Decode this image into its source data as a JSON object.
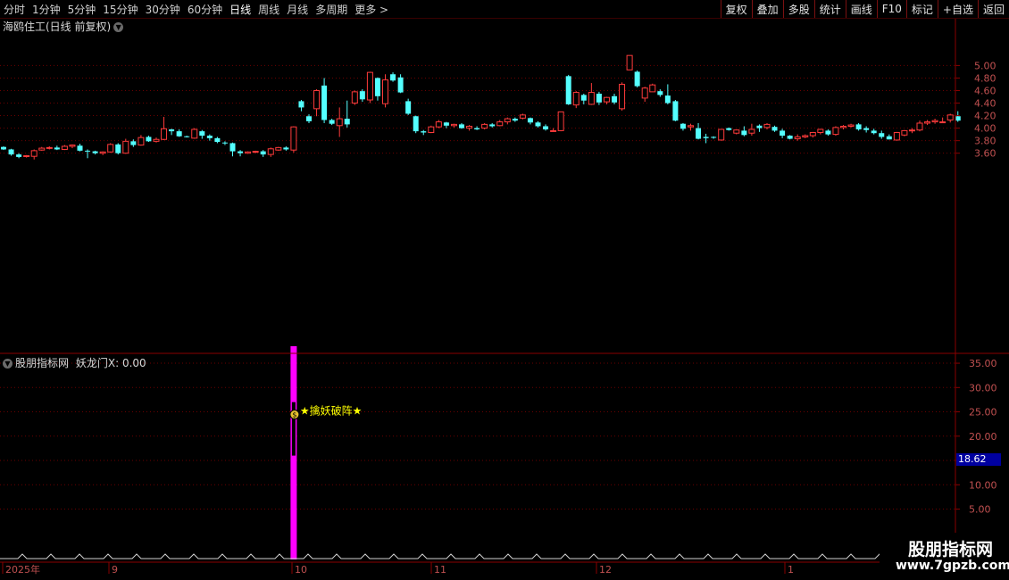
{
  "toolbar": {
    "periods": [
      "分时",
      "1分钟",
      "5分钟",
      "15分钟",
      "30分钟",
      "60分钟",
      "日线",
      "周线",
      "月线",
      "多周期",
      "更多 >"
    ],
    "active_period": "日线",
    "buttons": [
      "复权",
      "叠加",
      "多股",
      "统计",
      "画线",
      "F10",
      "标记",
      "+自选",
      "返回"
    ]
  },
  "main_chart": {
    "title": "海鸥住工(日线 前复权)",
    "y_ticks": [
      "5.00",
      "4.80",
      "4.60",
      "4.40",
      "4.20",
      "4.00",
      "3.80",
      "3.60"
    ]
  },
  "indicator": {
    "name": "股朋指标网",
    "label": "妖龙门X:",
    "value": "0.00",
    "signal_label": "擒妖破阵",
    "y_ticks": [
      "35.00",
      "30.00",
      "25.00",
      "20.00",
      "15.00",
      "10.00",
      "5.00"
    ],
    "price_tag": "18.62"
  },
  "x_axis": {
    "labels": [
      "2025年",
      "9",
      "10",
      "11",
      "12",
      "1"
    ]
  },
  "watermark": {
    "line1": "股朋指标网",
    "line2": "www.7gpzb.com"
  },
  "colors": {
    "up": "#ff3b3b",
    "down": "#54ffff",
    "grid": "#6b0000",
    "signal": "#ff00ff"
  },
  "chart_data": {
    "type": "candlestick",
    "ylim": [
      3.4,
      5.2
    ],
    "candles": [
      [
        3.7,
        3.66,
        3.71,
        3.65
      ],
      [
        3.66,
        3.58,
        3.67,
        3.56
      ],
      [
        3.58,
        3.54,
        3.6,
        3.52
      ],
      [
        3.55,
        3.56,
        3.57,
        3.53
      ],
      [
        3.55,
        3.64,
        3.66,
        3.5
      ],
      [
        3.65,
        3.68,
        3.7,
        3.64
      ],
      [
        3.68,
        3.69,
        3.71,
        3.66
      ],
      [
        3.69,
        3.66,
        3.72,
        3.65
      ],
      [
        3.66,
        3.71,
        3.73,
        3.65
      ],
      [
        3.71,
        3.73,
        3.74,
        3.68
      ],
      [
        3.72,
        3.64,
        3.75,
        3.63
      ],
      [
        3.64,
        3.63,
        3.66,
        3.52
      ],
      [
        3.63,
        3.6,
        3.64,
        3.58
      ],
      [
        3.6,
        3.62,
        3.63,
        3.57
      ],
      [
        3.62,
        3.74,
        3.76,
        3.61
      ],
      [
        3.74,
        3.6,
        3.76,
        3.58
      ],
      [
        3.6,
        3.79,
        3.83,
        3.59
      ],
      [
        3.79,
        3.73,
        3.82,
        3.7
      ],
      [
        3.73,
        3.85,
        3.89,
        3.72
      ],
      [
        3.86,
        3.79,
        3.88,
        3.78
      ],
      [
        3.79,
        3.82,
        3.85,
        3.77
      ],
      [
        3.82,
        3.99,
        4.18,
        3.81
      ],
      [
        3.98,
        3.95,
        3.99,
        3.89
      ],
      [
        3.95,
        3.87,
        3.98,
        3.86
      ],
      [
        3.87,
        3.86,
        3.88,
        3.85
      ],
      [
        3.84,
        3.98,
        4.0,
        3.83
      ],
      [
        3.95,
        3.88,
        3.97,
        3.83
      ],
      [
        3.88,
        3.84,
        3.9,
        3.8
      ],
      [
        3.84,
        3.78,
        3.86,
        3.76
      ],
      [
        3.77,
        3.76,
        3.79,
        3.73
      ],
      [
        3.76,
        3.63,
        3.77,
        3.55
      ],
      [
        3.63,
        3.6,
        3.65,
        3.55
      ],
      [
        3.6,
        3.62,
        3.63,
        3.59
      ],
      [
        3.62,
        3.63,
        3.64,
        3.6
      ],
      [
        3.63,
        3.58,
        3.65,
        3.54
      ],
      [
        3.58,
        3.67,
        3.69,
        3.54
      ],
      [
        3.65,
        3.69,
        3.7,
        3.64
      ],
      [
        3.69,
        3.66,
        3.71,
        3.64
      ],
      [
        3.65,
        4.02,
        4.03,
        3.61
      ],
      [
        4.43,
        4.33,
        4.45,
        4.27
      ],
      [
        4.19,
        4.11,
        4.22,
        4.08
      ],
      [
        4.31,
        4.6,
        4.62,
        4.19
      ],
      [
        4.68,
        4.13,
        4.8,
        4.08
      ],
      [
        4.13,
        4.07,
        4.15,
        4.05
      ],
      [
        4.04,
        4.15,
        4.33,
        3.86
      ],
      [
        4.15,
        4.06,
        4.44,
        4.01
      ],
      [
        4.4,
        4.58,
        4.6,
        4.37
      ],
      [
        4.59,
        4.46,
        4.62,
        4.42
      ],
      [
        4.45,
        4.89,
        4.9,
        4.4
      ],
      [
        4.8,
        4.51,
        4.81,
        4.44
      ],
      [
        4.39,
        4.77,
        4.86,
        4.33
      ],
      [
        4.86,
        4.76,
        4.89,
        4.74
      ],
      [
        4.81,
        4.57,
        4.86,
        4.56
      ],
      [
        4.43,
        4.23,
        4.47,
        4.21
      ],
      [
        4.19,
        3.95,
        4.2,
        3.92
      ],
      [
        3.95,
        3.93,
        3.97,
        3.89
      ],
      [
        3.93,
        4.02,
        4.04,
        3.92
      ],
      [
        4.02,
        4.1,
        4.13,
        4.0
      ],
      [
        4.09,
        4.04,
        4.1,
        4.0
      ],
      [
        4.04,
        4.06,
        4.07,
        4.01
      ],
      [
        4.06,
        4.0,
        4.08,
        3.99
      ],
      [
        4.0,
        4.03,
        4.05,
        3.96
      ],
      [
        4.0,
        3.98,
        4.03,
        3.97
      ],
      [
        4.0,
        4.06,
        4.08,
        3.98
      ],
      [
        4.06,
        4.03,
        4.08,
        4.01
      ],
      [
        4.04,
        4.1,
        4.13,
        4.03
      ],
      [
        4.1,
        4.15,
        4.17,
        4.06
      ],
      [
        4.15,
        4.12,
        4.17,
        4.1
      ],
      [
        4.16,
        4.21,
        4.23,
        4.14
      ],
      [
        4.16,
        4.09,
        4.17,
        4.06
      ],
      [
        4.09,
        4.03,
        4.11,
        4.01
      ],
      [
        4.03,
        3.98,
        4.06,
        3.96
      ],
      [
        3.96,
        3.96,
        4.0,
        3.96
      ],
      [
        3.96,
        4.26,
        4.26,
        3.95
      ],
      [
        4.83,
        4.38,
        4.85,
        4.37
      ],
      [
        4.37,
        4.57,
        4.59,
        4.32
      ],
      [
        4.53,
        4.44,
        4.55,
        4.38
      ],
      [
        4.38,
        4.57,
        4.72,
        4.37
      ],
      [
        4.55,
        4.41,
        4.58,
        4.37
      ],
      [
        4.42,
        4.49,
        4.5,
        4.38
      ],
      [
        4.51,
        4.41,
        4.55,
        4.38
      ],
      [
        4.31,
        4.7,
        4.73,
        4.28
      ],
      [
        4.93,
        5.16,
        5.16,
        4.95
      ],
      [
        4.9,
        4.67,
        4.92,
        4.65
      ],
      [
        4.48,
        4.64,
        4.66,
        4.42
      ],
      [
        4.58,
        4.69,
        4.71,
        4.6
      ],
      [
        4.59,
        4.53,
        4.62,
        4.5
      ],
      [
        4.52,
        4.4,
        4.7,
        4.38
      ],
      [
        4.43,
        4.12,
        4.45,
        4.11
      ],
      [
        4.07,
        3.99,
        4.08,
        3.96
      ],
      [
        4.02,
        4.04,
        4.07,
        3.96
      ],
      [
        4.0,
        3.83,
        4.08,
        3.82
      ],
      [
        3.86,
        3.84,
        3.91,
        3.76
      ],
      [
        3.86,
        3.85,
        3.87,
        3.83
      ],
      [
        3.81,
        3.98,
        3.97,
        3.8
      ],
      [
        4.0,
        3.97,
        4.01,
        3.96
      ],
      [
        3.92,
        3.97,
        3.98,
        3.9
      ],
      [
        3.96,
        3.89,
        4.03,
        3.87
      ],
      [
        3.92,
        3.98,
        4.07,
        3.88
      ],
      [
        4.04,
        4.0,
        4.06,
        3.94
      ],
      [
        4.01,
        4.06,
        4.08,
        3.98
      ],
      [
        4.02,
        3.96,
        4.04,
        3.94
      ],
      [
        3.96,
        3.88,
        3.99,
        3.84
      ],
      [
        3.88,
        3.83,
        3.89,
        3.82
      ],
      [
        3.83,
        3.86,
        3.9,
        3.8
      ],
      [
        3.86,
        3.88,
        3.9,
        3.84
      ],
      [
        3.88,
        3.93,
        3.94,
        3.85
      ],
      [
        3.93,
        3.98,
        3.99,
        3.9
      ],
      [
        3.96,
        3.9,
        3.98,
        3.88
      ],
      [
        3.9,
        4.01,
        4.03,
        3.88
      ],
      [
        4.01,
        4.03,
        4.05,
        3.98
      ],
      [
        4.03,
        4.05,
        4.07,
        4.01
      ],
      [
        4.06,
        3.98,
        4.08,
        3.96
      ],
      [
        4.0,
        3.97,
        4.03,
        3.93
      ],
      [
        3.96,
        3.92,
        3.99,
        3.9
      ],
      [
        3.92,
        3.86,
        3.96,
        3.83
      ],
      [
        3.87,
        3.82,
        3.9,
        3.82
      ],
      [
        3.81,
        3.93,
        3.94,
        3.8
      ],
      [
        3.89,
        3.96,
        3.97,
        3.87
      ],
      [
        3.96,
        3.97,
        4.0,
        3.92
      ],
      [
        3.97,
        4.08,
        4.12,
        3.95
      ],
      [
        4.08,
        4.1,
        4.13,
        4.05
      ],
      [
        4.1,
        4.12,
        4.15,
        4.07
      ],
      [
        4.1,
        4.1,
        4.17,
        4.08
      ],
      [
        4.13,
        4.21,
        4.23,
        4.09
      ],
      [
        4.19,
        4.12,
        4.27,
        4.1
      ]
    ],
    "indicator_signal": {
      "index": 38,
      "top": 38.5,
      "mark_center": 25,
      "value": 0.0
    }
  }
}
